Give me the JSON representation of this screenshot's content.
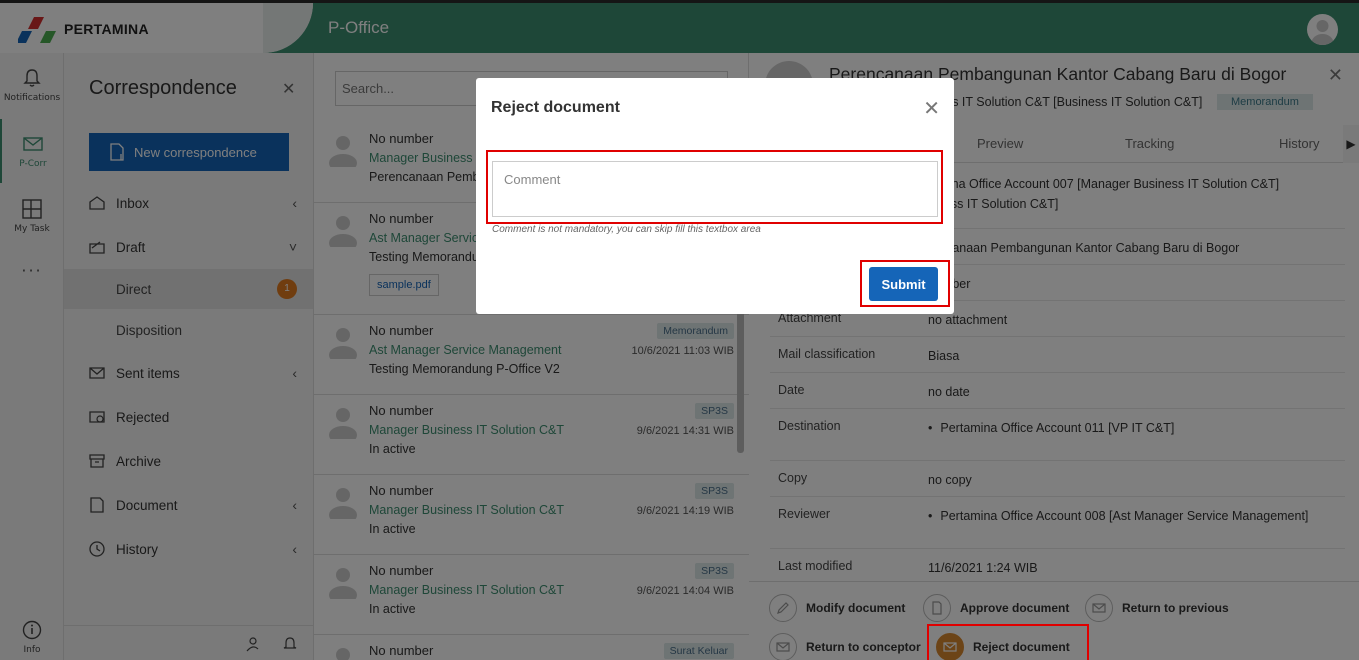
{
  "brand": {
    "name": "PERTAMINA",
    "app_title": "P-Office"
  },
  "rail": {
    "items": [
      {
        "label": "Notifications"
      },
      {
        "label": "P-Corr"
      },
      {
        "label": "My Task"
      },
      {
        "label": "Info"
      }
    ],
    "more": "···"
  },
  "sidebar": {
    "title": "Correspondence",
    "close": "✕",
    "new_button": "New correspondence",
    "items": [
      {
        "label": "Inbox",
        "chev": "‹"
      },
      {
        "label": "Draft",
        "chev": "˅"
      },
      {
        "label": "Direct",
        "badge": "1"
      },
      {
        "label": "Disposition"
      },
      {
        "label": "Sent items",
        "chev": "‹"
      },
      {
        "label": "Rejected"
      },
      {
        "label": "Archive"
      },
      {
        "label": "Document",
        "chev": "‹"
      },
      {
        "label": "History",
        "chev": "‹"
      }
    ]
  },
  "list": {
    "search_placeholder": "Search...",
    "rows": [
      {
        "number": "No number",
        "sender": "Manager Business I",
        "subject": "Perencanaan Pemba"
      },
      {
        "number": "No number",
        "sender": "Ast Manager Servic",
        "subject": "Testing Memorandu",
        "attachment": "sample.pdf"
      },
      {
        "number": "No number",
        "sender": "Ast Manager Service Management",
        "subject": "Testing Memorandung P-Office V2",
        "tag": "Memorandum",
        "date": "10/6/2021 11:03 WIB"
      },
      {
        "number": "No number",
        "sender": "Manager Business IT Solution C&T",
        "subject": "In active",
        "tag": "SP3S",
        "date": "9/6/2021 14:31 WIB"
      },
      {
        "number": "No number",
        "sender": "Manager Business IT Solution C&T",
        "subject": "In active",
        "tag": "SP3S",
        "date": "9/6/2021 14:19 WIB"
      },
      {
        "number": "No number",
        "sender": "Manager Business IT Solution C&T",
        "subject": "In active",
        "tag": "SP3S",
        "date": "9/6/2021 14:04 WIB"
      },
      {
        "number": "No number",
        "tag": "Surat Keluar"
      }
    ]
  },
  "detail": {
    "title": "Perencanaan Pembangunan Kantor Cabang Baru di Bogor",
    "subtitle": "ess IT Solution C&T [Business IT Solution C&T]",
    "type_badge": "Memorandum",
    "close": "✕",
    "tabs": [
      "Preview",
      "Tracking",
      "History"
    ],
    "tab_arrow": "▶",
    "fields": [
      {
        "key": "",
        "value": "tamina Office Account 007 [Manager Business IT Solution C&T]",
        "value2": "siness IT Solution C&T]"
      },
      {
        "key": "",
        "value": "rencanaan Pembangunan Kantor Cabang Baru di Bogor"
      },
      {
        "key": "",
        "value": "number"
      },
      {
        "key": "Attachment",
        "value": "no attachment"
      },
      {
        "key": "Mail classification",
        "value": "Biasa"
      },
      {
        "key": "Date",
        "value": "no date"
      },
      {
        "key": "Destination",
        "value": "Pertamina Office Account 011 [VP IT C&T]"
      },
      {
        "key": "Copy",
        "value": "no copy"
      },
      {
        "key": "Reviewer",
        "value": "Pertamina Office Account 008 [Ast Manager Service Management]"
      },
      {
        "key": "Last modified",
        "value": "11/6/2021 1:24 WIB"
      }
    ],
    "actions": [
      {
        "label": "Modify document"
      },
      {
        "label": "Approve document"
      },
      {
        "label": "Return to previous"
      },
      {
        "label": "Return to conceptor"
      },
      {
        "label": "Reject document"
      }
    ]
  },
  "modal": {
    "title": "Reject document",
    "close": "✕",
    "comment_placeholder": "Comment",
    "hint": "Comment is not mandatory, you can skip fill this textbox area",
    "submit": "Submit"
  },
  "colors": {
    "brand_green": "#3d8e71",
    "primary_blue": "#1565b8",
    "highlight_red": "#e00000",
    "badge_orange": "#e07a1f"
  }
}
